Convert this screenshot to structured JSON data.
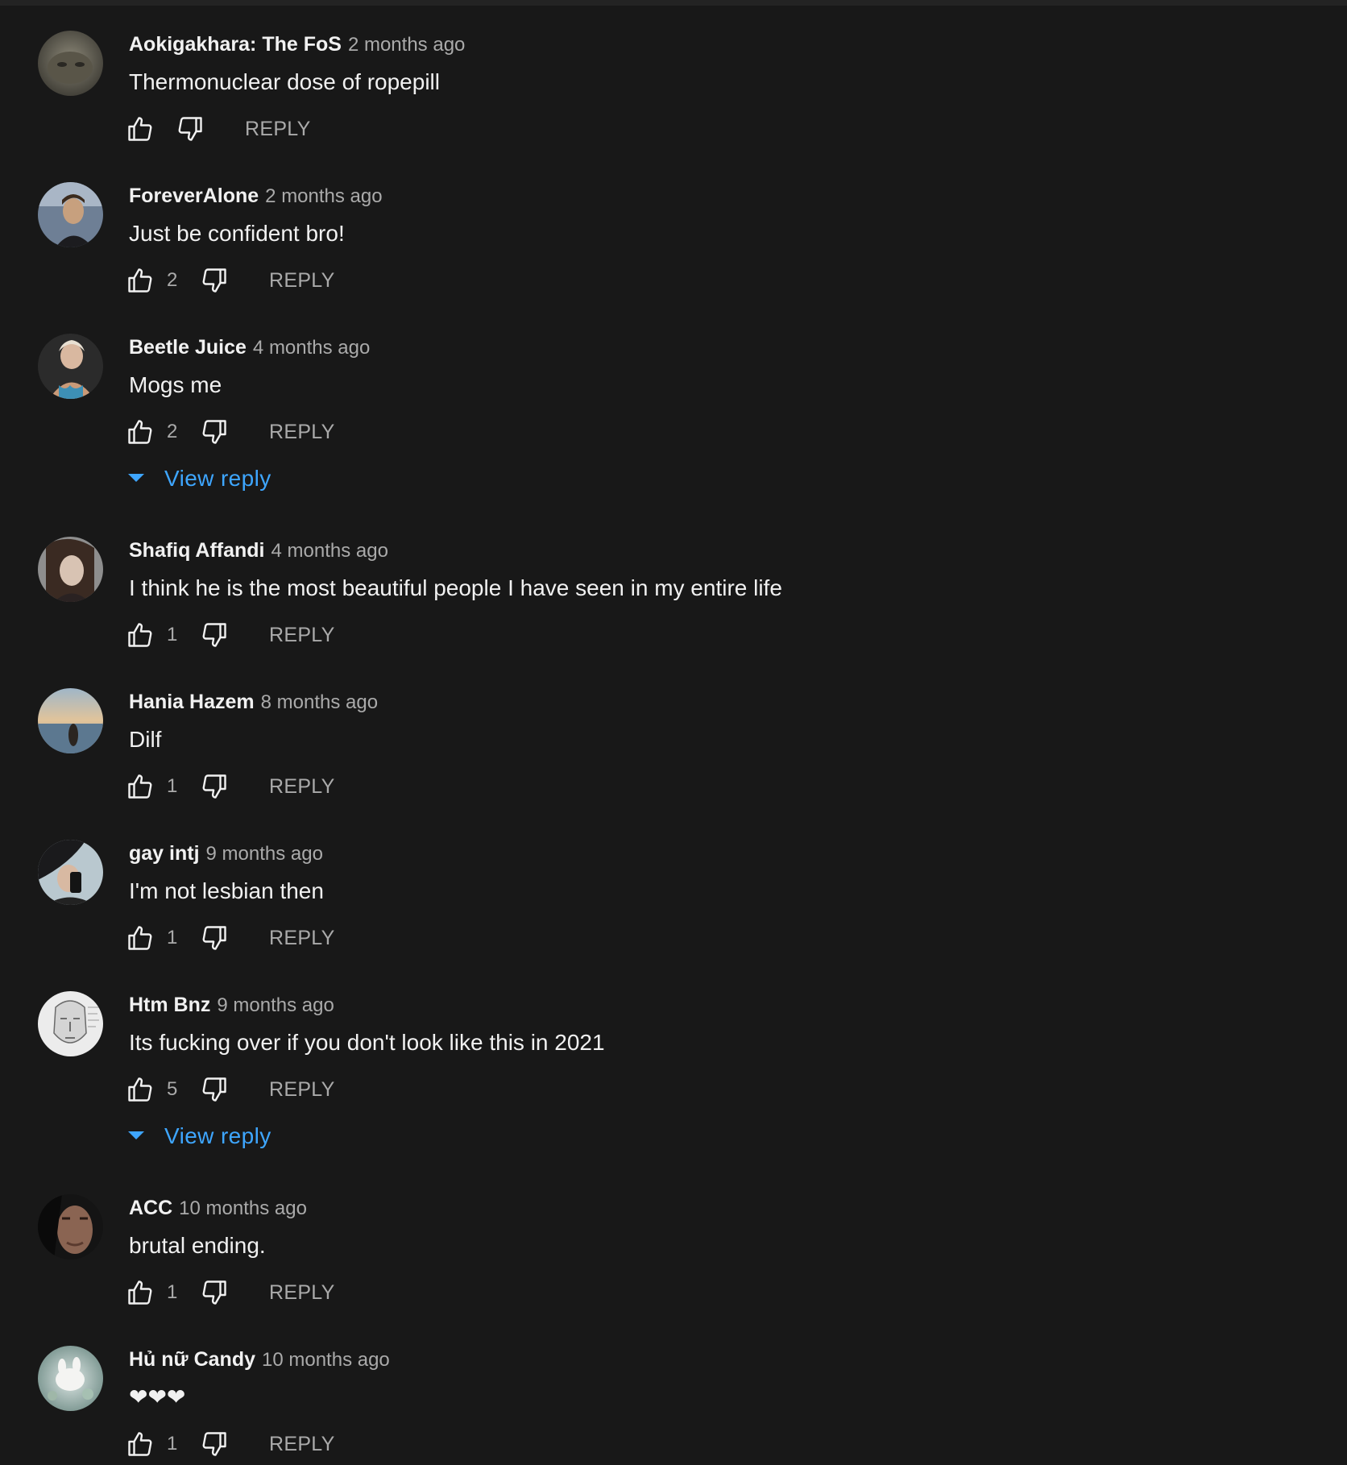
{
  "colors": {
    "background": "#181818",
    "author": "#f1f1f1",
    "meta": "#aaaaaa",
    "link": "#3ea6ff"
  },
  "icons": {
    "like": "thumb-up-icon",
    "dislike": "thumb-down-icon",
    "expand": "caret-down-icon"
  },
  "comments": [
    {
      "author": "Aokigakhara: The FoS",
      "time": "2 months ago",
      "text": "Thermonuclear dose of ropepill",
      "likes": "",
      "reply_label": "REPLY"
    },
    {
      "author": "ForeverAlone",
      "time": "2 months ago",
      "text": "Just be confident bro!",
      "likes": "2",
      "reply_label": "REPLY"
    },
    {
      "author": "Beetle Juice",
      "time": "4 months ago",
      "text": "Mogs me",
      "likes": "2",
      "reply_label": "REPLY",
      "view_replies": "View reply"
    },
    {
      "author": "Shafiq Affandi",
      "time": "4 months ago",
      "text": "I think he is the most beautiful people I have seen in my entire life",
      "likes": "1",
      "reply_label": "REPLY"
    },
    {
      "author": "Hania Hazem",
      "time": "8 months ago",
      "text": "Dilf",
      "likes": "1",
      "reply_label": "REPLY"
    },
    {
      "author": "gay intj",
      "time": "9 months ago",
      "text": "I'm not lesbian then",
      "likes": "1",
      "reply_label": "REPLY"
    },
    {
      "author": "Htm Bnz",
      "time": "9 months ago",
      "text": "Its fucking over if you don't look like this in 2021",
      "likes": "5",
      "reply_label": "REPLY",
      "view_replies": "View reply"
    },
    {
      "author": "ACC",
      "time": "10 months ago",
      "text": "brutal ending.",
      "likes": "1",
      "reply_label": "REPLY"
    },
    {
      "author": "Hủ nữ Candy",
      "time": "10 months ago",
      "text": "❤❤❤",
      "likes": "1",
      "reply_label": "REPLY"
    }
  ]
}
